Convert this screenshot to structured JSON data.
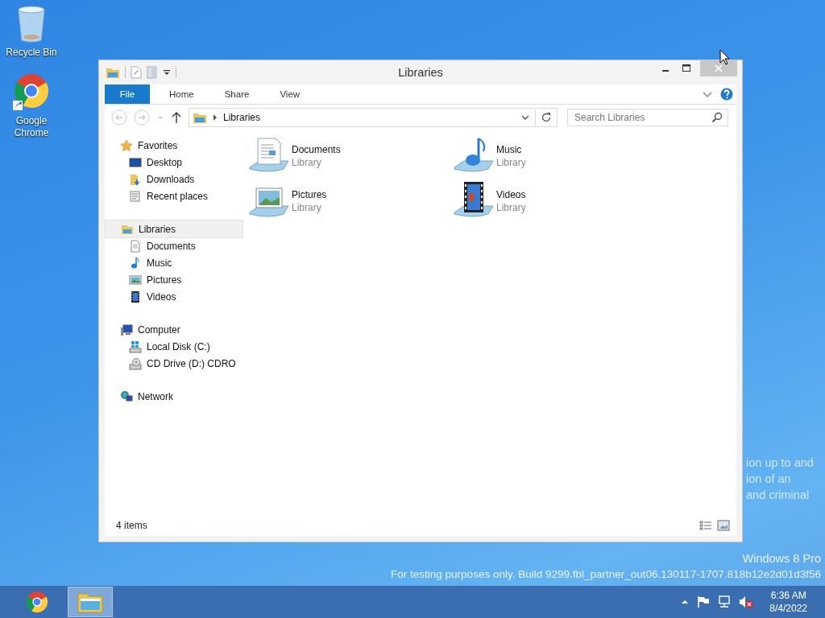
{
  "desktop_icons": [
    {
      "label": "Recycle Bin",
      "kind": "recycle"
    },
    {
      "label": "Google Chrome",
      "kind": "chrome"
    }
  ],
  "desktop_notice_lines": [
    "ion up to and",
    "ion of an",
    "and criminal"
  ],
  "window": {
    "title": "Libraries",
    "ribbon_tabs": [
      {
        "label": "File",
        "kind": "menu",
        "selected": false
      },
      {
        "label": "Home",
        "kind": "tab",
        "selected": false
      },
      {
        "label": "Share",
        "kind": "tab",
        "selected": false
      },
      {
        "label": "View",
        "kind": "tab",
        "selected": false
      }
    ],
    "address": {
      "path": "Libraries"
    },
    "search": {
      "placeholder": "Search Libraries"
    },
    "nav": [
      {
        "label": "Favorites",
        "kind": "favorites",
        "selected": false,
        "children": [
          {
            "label": "Desktop",
            "kind": "desktop",
            "selected": false
          },
          {
            "label": "Downloads",
            "kind": "downloads",
            "selected": false
          },
          {
            "label": "Recent places",
            "kind": "recent",
            "selected": false
          }
        ]
      },
      {
        "label": "Libraries",
        "kind": "libraries",
        "selected": true,
        "children": [
          {
            "label": "Documents",
            "kind": "documents",
            "selected": false
          },
          {
            "label": "Music",
            "kind": "music",
            "selected": false
          },
          {
            "label": "Pictures",
            "kind": "pictures",
            "selected": false
          },
          {
            "label": "Videos",
            "kind": "videos",
            "selected": false
          }
        ]
      },
      {
        "label": "Computer",
        "kind": "computer",
        "selected": false,
        "children": [
          {
            "label": "Local Disk (C:)",
            "kind": "disk",
            "selected": false
          },
          {
            "label": "CD Drive (D:) CDRO",
            "kind": "cdrom",
            "selected": false
          }
        ]
      },
      {
        "label": "Network",
        "kind": "network",
        "selected": false
      }
    ],
    "items": [
      {
        "name": "Documents",
        "type": "Library",
        "kind": "documents"
      },
      {
        "name": "Music",
        "type": "Library",
        "kind": "music"
      },
      {
        "name": "Pictures",
        "type": "Library",
        "kind": "pictures"
      },
      {
        "name": "Videos",
        "type": "Library",
        "kind": "videos"
      }
    ],
    "status_bar": {
      "count": "4 items"
    }
  },
  "edition": "Windows 8 Pro",
  "build_notice": "For testing purposes only. Build 9299.fbl_partner_out06.130117-1707.818b12e2d01d3f56",
  "taskbar": {
    "apps": [
      {
        "kind": "chrome",
        "selected": false
      },
      {
        "kind": "explorer",
        "selected": true
      }
    ],
    "clock": {
      "time": "6:36 AM",
      "date": "8/4/2022"
    }
  }
}
